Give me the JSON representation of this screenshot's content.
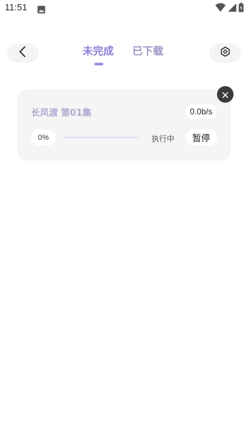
{
  "status_bar": {
    "time": "11:51",
    "icons": [
      "image-icon",
      "wifi-icon",
      "signal-icon",
      "battery-icon"
    ]
  },
  "header": {
    "back_icon": "chevron-left-icon",
    "settings_icon": "hexagon-settings-icon",
    "tabs": [
      {
        "label": "未完成",
        "active": true
      },
      {
        "label": "已下载",
        "active": false
      }
    ]
  },
  "downloads": [
    {
      "title": "长风渡 第01集",
      "speed": "0.0b/s",
      "progress_text": "0%",
      "progress": 0,
      "status": "执行中",
      "action_label": "暂停"
    }
  ],
  "colors": {
    "accent": "#8b7fd6",
    "tab_inactive": "#9a96c4",
    "card_bg": "#f5f5f5",
    "close_bg": "#3b3b3b"
  }
}
